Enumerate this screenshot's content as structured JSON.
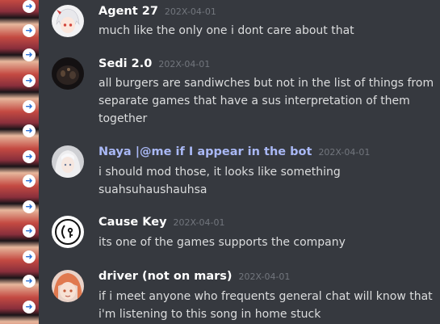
{
  "messages": [
    {
      "author": "Agent 27",
      "timestamp": "202X-04-01",
      "text": "much like the only one i dont care about that",
      "name_color": "#ffffff",
      "avatar_icon": "anime-girl-avatar"
    },
    {
      "author": "Sedi 2.0",
      "timestamp": "202X-04-01",
      "text": "all burgers are sandiwches but not in the list of things from separate games that have a sus interpretation of them together",
      "name_color": "#ffffff",
      "avatar_icon": "dark-scene-avatar"
    },
    {
      "author": "Naya |@me if I appear in the bot",
      "timestamp": "202X-04-01",
      "text": "i should mod those, it looks like something suahsuhaushauhsa",
      "name_color": "#a9b8f5",
      "avatar_icon": "white-hair-girl-avatar"
    },
    {
      "author": "Cause Key",
      "timestamp": "202X-04-01",
      "text": "its one of the games supports the company",
      "name_color": "#ffffff",
      "avatar_icon": "cause-key-logo-avatar"
    },
    {
      "author": "driver (not on mars)",
      "timestamp": "202X-04-01",
      "text": "if i meet anyone who frequents general chat will know that i'm listening to this song in home stuck",
      "name_color": "#ffffff",
      "avatar_icon": "orange-hair-avatar"
    }
  ]
}
